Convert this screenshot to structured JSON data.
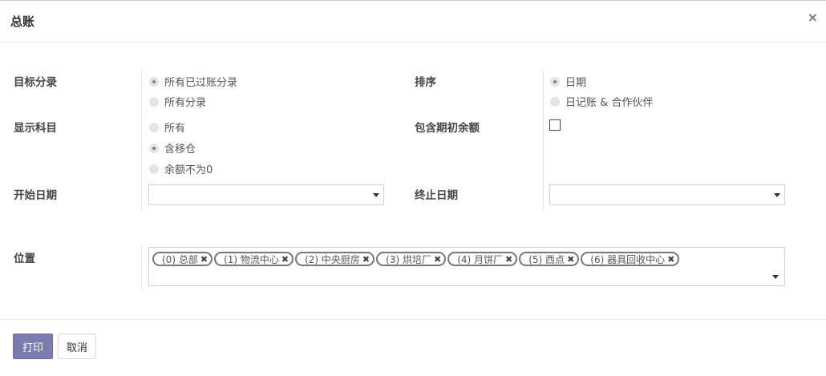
{
  "dialog": {
    "title": "总账"
  },
  "labels": {
    "target_move": "目标分录",
    "sort": "排序",
    "display_account": "显示科目",
    "initial_balance": "包含期初余额",
    "date_from": "开始日期",
    "date_to": "终止日期",
    "location": "位置"
  },
  "target_move": {
    "options": [
      {
        "label": "所有已过账分录",
        "selected": true
      },
      {
        "label": "所有分录",
        "selected": false
      }
    ]
  },
  "sort": {
    "options": [
      {
        "label": "日期",
        "selected": true
      },
      {
        "label": "日记账 & 合作伙伴",
        "selected": false
      }
    ]
  },
  "display_account": {
    "options": [
      {
        "label": "所有",
        "selected": false
      },
      {
        "label": "含移仓",
        "selected": true
      },
      {
        "label": "余额不为0",
        "selected": false
      }
    ]
  },
  "initial_balance": {
    "checked": false
  },
  "date_from": {
    "value": ""
  },
  "date_to": {
    "value": ""
  },
  "locations": {
    "tags": [
      "(0) 总部",
      "(1) 物流中心",
      "(2) 中央厨房",
      "(3) 烘培厂",
      "(4) 月饼厂",
      "(5) 西点",
      "(6) 器具回收中心"
    ]
  },
  "footer": {
    "print_label": "打印",
    "cancel_label": "取消"
  },
  "colors": {
    "accent": "#7c7bad",
    "border": "#cfcfcf"
  }
}
